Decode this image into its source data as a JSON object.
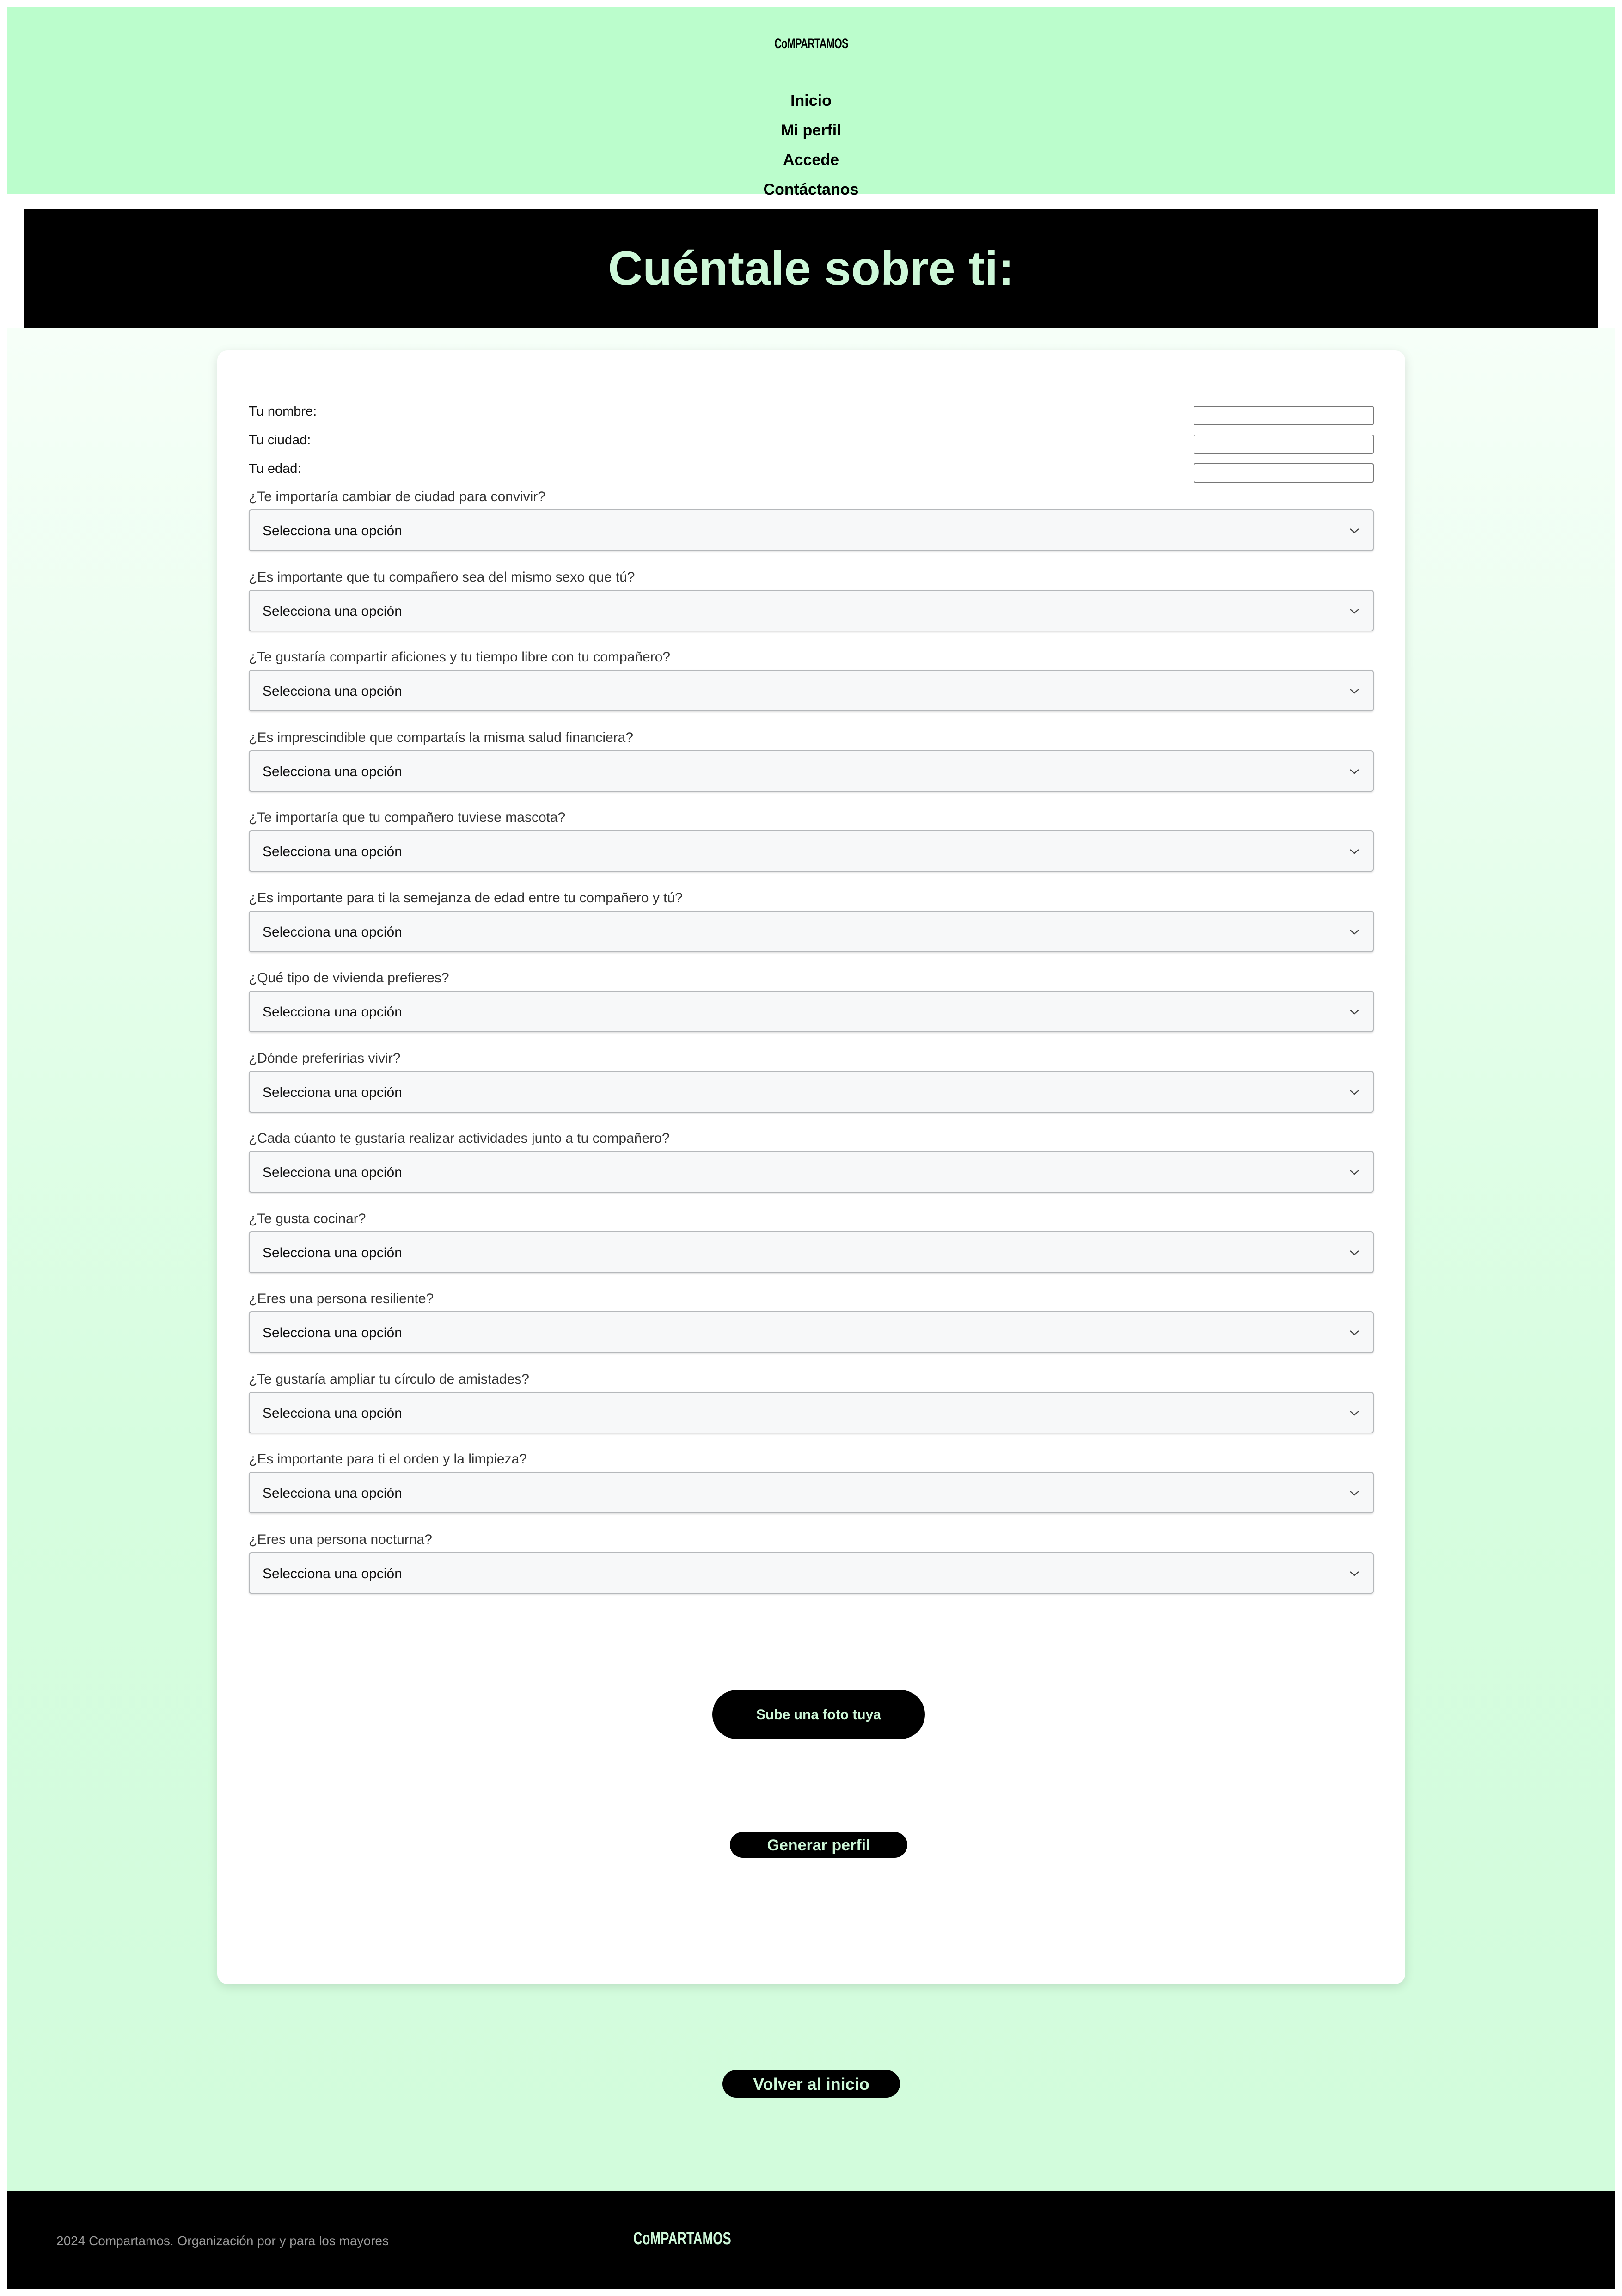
{
  "brand": {
    "logo": "CoMPARTAMOS",
    "accent": "#bbfdcc",
    "heading_color": "#cdf7d8"
  },
  "nav": {
    "items": [
      "Inicio",
      "Mi perfil",
      "Accede",
      "Contáctanos"
    ]
  },
  "banner": {
    "title": "Cuéntale sobre ti:"
  },
  "form": {
    "text_fields": [
      {
        "label": "Tu nombre:",
        "value": ""
      },
      {
        "label": "Tu ciudad:",
        "value": ""
      },
      {
        "label": "Tu edad:",
        "value": ""
      }
    ],
    "select_placeholder": "Selecciona una opción",
    "questions": [
      "¿Te importaría cambiar de ciudad para convivir?",
      "¿Es importante que tu compañero sea del mismo sexo que tú?",
      "¿Te gustaría compartir aficiones y tu tiempo libre con tu compañero?",
      "¿Es imprescindible que compartaís la misma salud financiera?",
      "¿Te importaría que tu compañero tuviese mascota?",
      "¿Es importante para ti la semejanza de edad entre tu compañero y tú?",
      "¿Qué tipo de vivienda prefieres?",
      "¿Dónde preferírias vivir?",
      "¿Cada cúanto te gustaría realizar actividades junto a tu compañero?",
      "¿Te gusta cocinar?",
      "¿Eres una persona resiliente?",
      "¿Te gustaría ampliar tu círculo de amistades?",
      "¿Es importante para ti el orden y la limpieza?",
      "¿Eres una persona nocturna?"
    ],
    "photo_button": "Sube una foto tuya",
    "submit_button": "Generar perfil"
  },
  "back_button": "Volver al inicio",
  "footer": {
    "copyright": "2024 Compartamos. Organización por y para los mayores",
    "logo": "CoMPARTAMOS"
  }
}
